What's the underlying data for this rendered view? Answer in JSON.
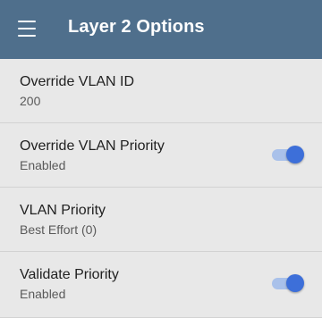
{
  "app_bar": {
    "title": "Layer 2 Options",
    "menu_icon": "hamburger-menu-icon",
    "background_color": "#4f6f8c"
  },
  "settings": [
    {
      "title": "Override VLAN ID",
      "value": "200"
    },
    {
      "title": "Override VLAN Priority",
      "value": "Enabled",
      "toggle": true
    },
    {
      "title": "VLAN Priority",
      "value": "Best Effort (0)"
    },
    {
      "title": "Validate Priority",
      "value": "Enabled",
      "toggle": true
    }
  ],
  "colors": {
    "toggle_on": "#3d6fd9",
    "toggle_track_on": "#a9c1ea",
    "background": "#e8e8e8"
  }
}
